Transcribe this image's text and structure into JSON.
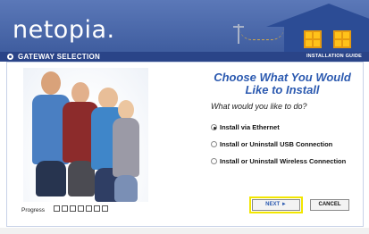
{
  "header": {
    "logo": "netopia",
    "logo_suffix": "."
  },
  "subbar": {
    "section": "GATEWAY SELECTION",
    "guide": "INSTALLATION GUIDE"
  },
  "content": {
    "heading_line1": "Choose What You Would",
    "heading_line2": "Like to Install",
    "question": "What would you like to do?",
    "options": [
      {
        "label": "Install via Ethernet",
        "selected": true
      },
      {
        "label": "Install or Uninstall USB Connection",
        "selected": false
      },
      {
        "label": "Install or Uninstall Wireless Connection",
        "selected": false
      }
    ]
  },
  "footer": {
    "progress_label": "Progress",
    "next_label": "NEXT",
    "cancel_label": "CANCEL"
  },
  "icons": {
    "next": "arrow-right",
    "section": "circle-marker"
  },
  "colors": {
    "header_blue": "#3f5d9f",
    "subbar_blue": "#2a4488",
    "accent_blue": "#2c5ab0",
    "highlight_yellow": "#f2e600"
  }
}
